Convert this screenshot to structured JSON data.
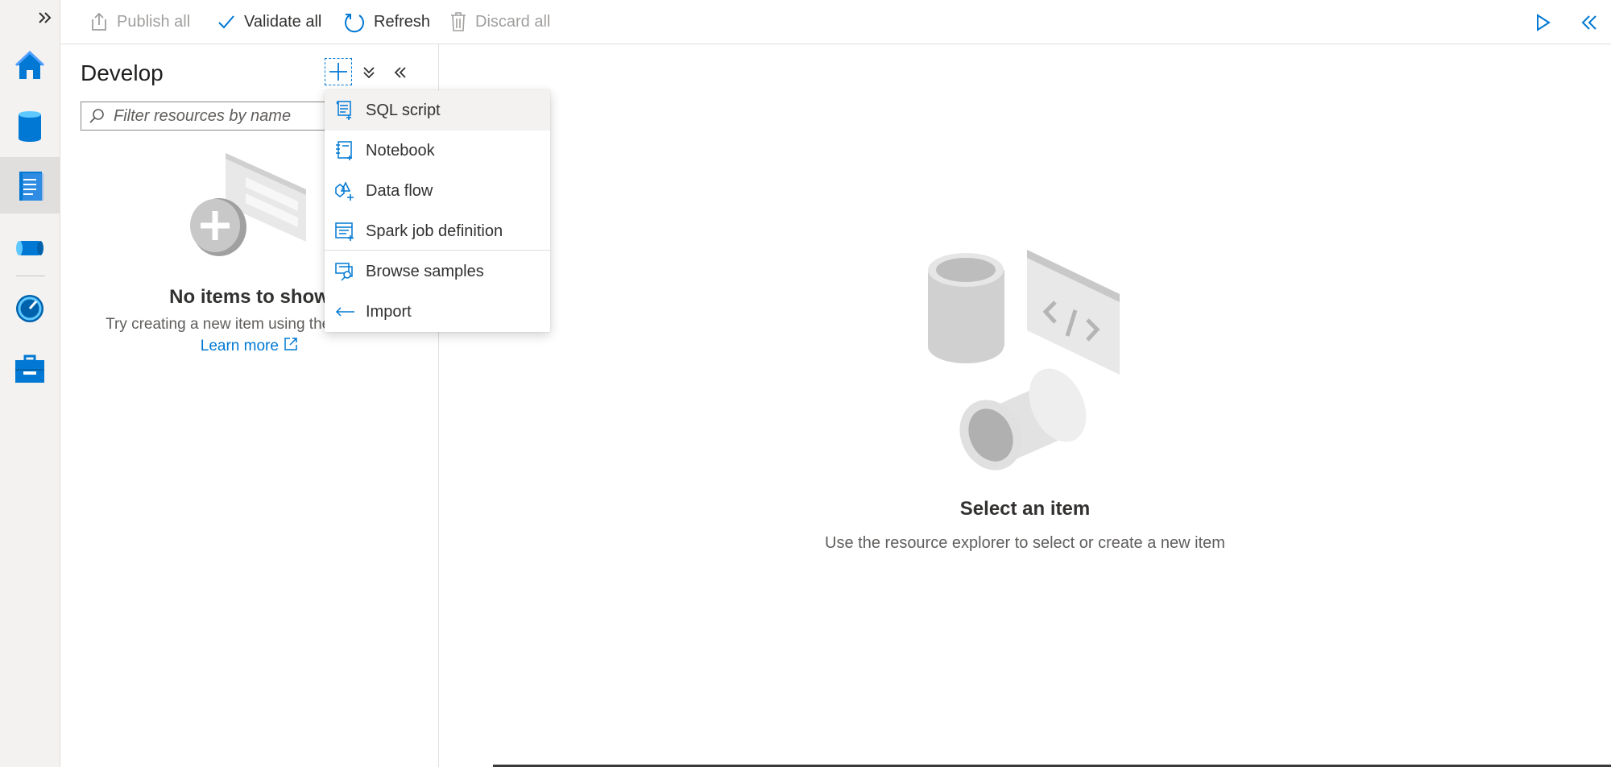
{
  "commandbar": {
    "publish_all": "Publish all",
    "validate_all": "Validate all",
    "refresh": "Refresh",
    "discard_all": "Discard all"
  },
  "nav": {
    "items": [
      "home-icon",
      "data-icon",
      "develop-icon",
      "integrate-icon",
      "monitor-icon",
      "manage-icon"
    ],
    "active": "develop-icon"
  },
  "panel": {
    "title": "Develop",
    "filter_placeholder": "Filter resources by name",
    "empty_title": "No items to show",
    "empty_sub": "Try creating a new item using the + above.",
    "learn_more": "Learn more"
  },
  "menu": {
    "items": [
      {
        "label": "SQL script",
        "icon": "sql-script-icon"
      },
      {
        "label": "Notebook",
        "icon": "notebook-icon"
      },
      {
        "label": "Data flow",
        "icon": "data-flow-icon"
      },
      {
        "label": "Spark job definition",
        "icon": "spark-job-icon"
      },
      {
        "label": "Browse samples",
        "icon": "browse-samples-icon"
      },
      {
        "label": "Import",
        "icon": "import-icon"
      }
    ]
  },
  "main": {
    "title": "Select an item",
    "subtitle": "Use the resource explorer to select or create a new item"
  },
  "colors": {
    "accent": "#0078d4",
    "rail_bg": "#f3f2f1"
  }
}
